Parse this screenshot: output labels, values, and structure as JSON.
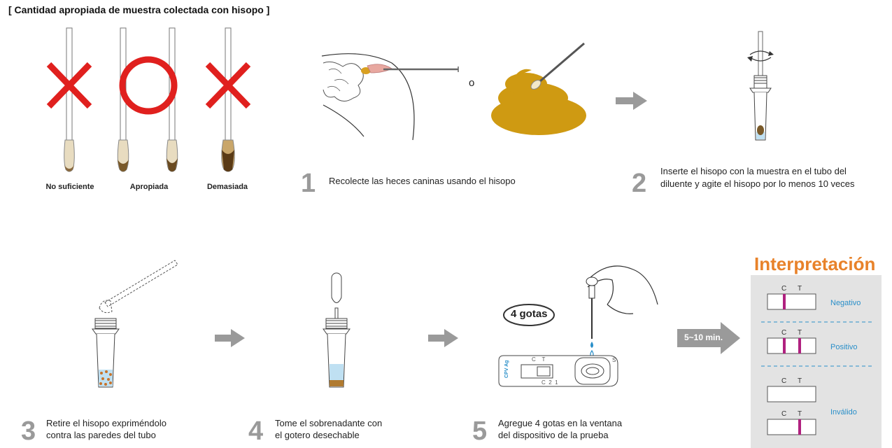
{
  "title": "[ Cantidad apropiada de muestra colectada con hisopo ]",
  "swabs": [
    {
      "label": "No suficiente",
      "mark": "x"
    },
    {
      "label": "Apropiada",
      "mark": "o"
    },
    {
      "label": "Demasiada",
      "mark": "x"
    }
  ],
  "steps": [
    {
      "number": "1",
      "lines": [
        "Recolecte las heces caninas usando el hisopo"
      ]
    },
    {
      "number": "2",
      "lines": [
        "Inserte el hisopo con la muestra en el tubo del",
        "diluente y agite el hisopo por lo menos 10 veces"
      ]
    },
    {
      "number": "3",
      "lines": [
        "Retire el hisopo expriméndolo",
        "contra las paredes del tubo"
      ]
    },
    {
      "number": "4",
      "lines": [
        "Tome el sobrenadante con",
        "el gotero desechable"
      ]
    },
    {
      "number": "5",
      "lines": [
        "Agregue 4 gotas en la ventana",
        "del dispositivo de la prueba"
      ]
    }
  ],
  "or_text": "o",
  "drops_label": "4 gotas",
  "time_label": "5~10 min.",
  "device_text": {
    "brand": "CPV Ag",
    "c_t": "C    T",
    "c21": "C  2  1",
    "s": "S"
  },
  "interpretation": {
    "title": "Interpretación",
    "results": [
      {
        "label": "Negativo",
        "c": "C",
        "t": "T"
      },
      {
        "label": "Positivo",
        "c": "C",
        "t": "T"
      },
      {
        "label": "Inválido",
        "c": "C",
        "t": "T"
      },
      {
        "label": "",
        "c": "C",
        "t": "T"
      }
    ]
  },
  "colors": {
    "red_mark": "#e0201e",
    "orange_title": "#e8822a",
    "blue_label": "#2a8fc9",
    "arrow_gray": "#9a9a9a",
    "stool": "#cf9a12",
    "line_purple": "#b0217f"
  }
}
